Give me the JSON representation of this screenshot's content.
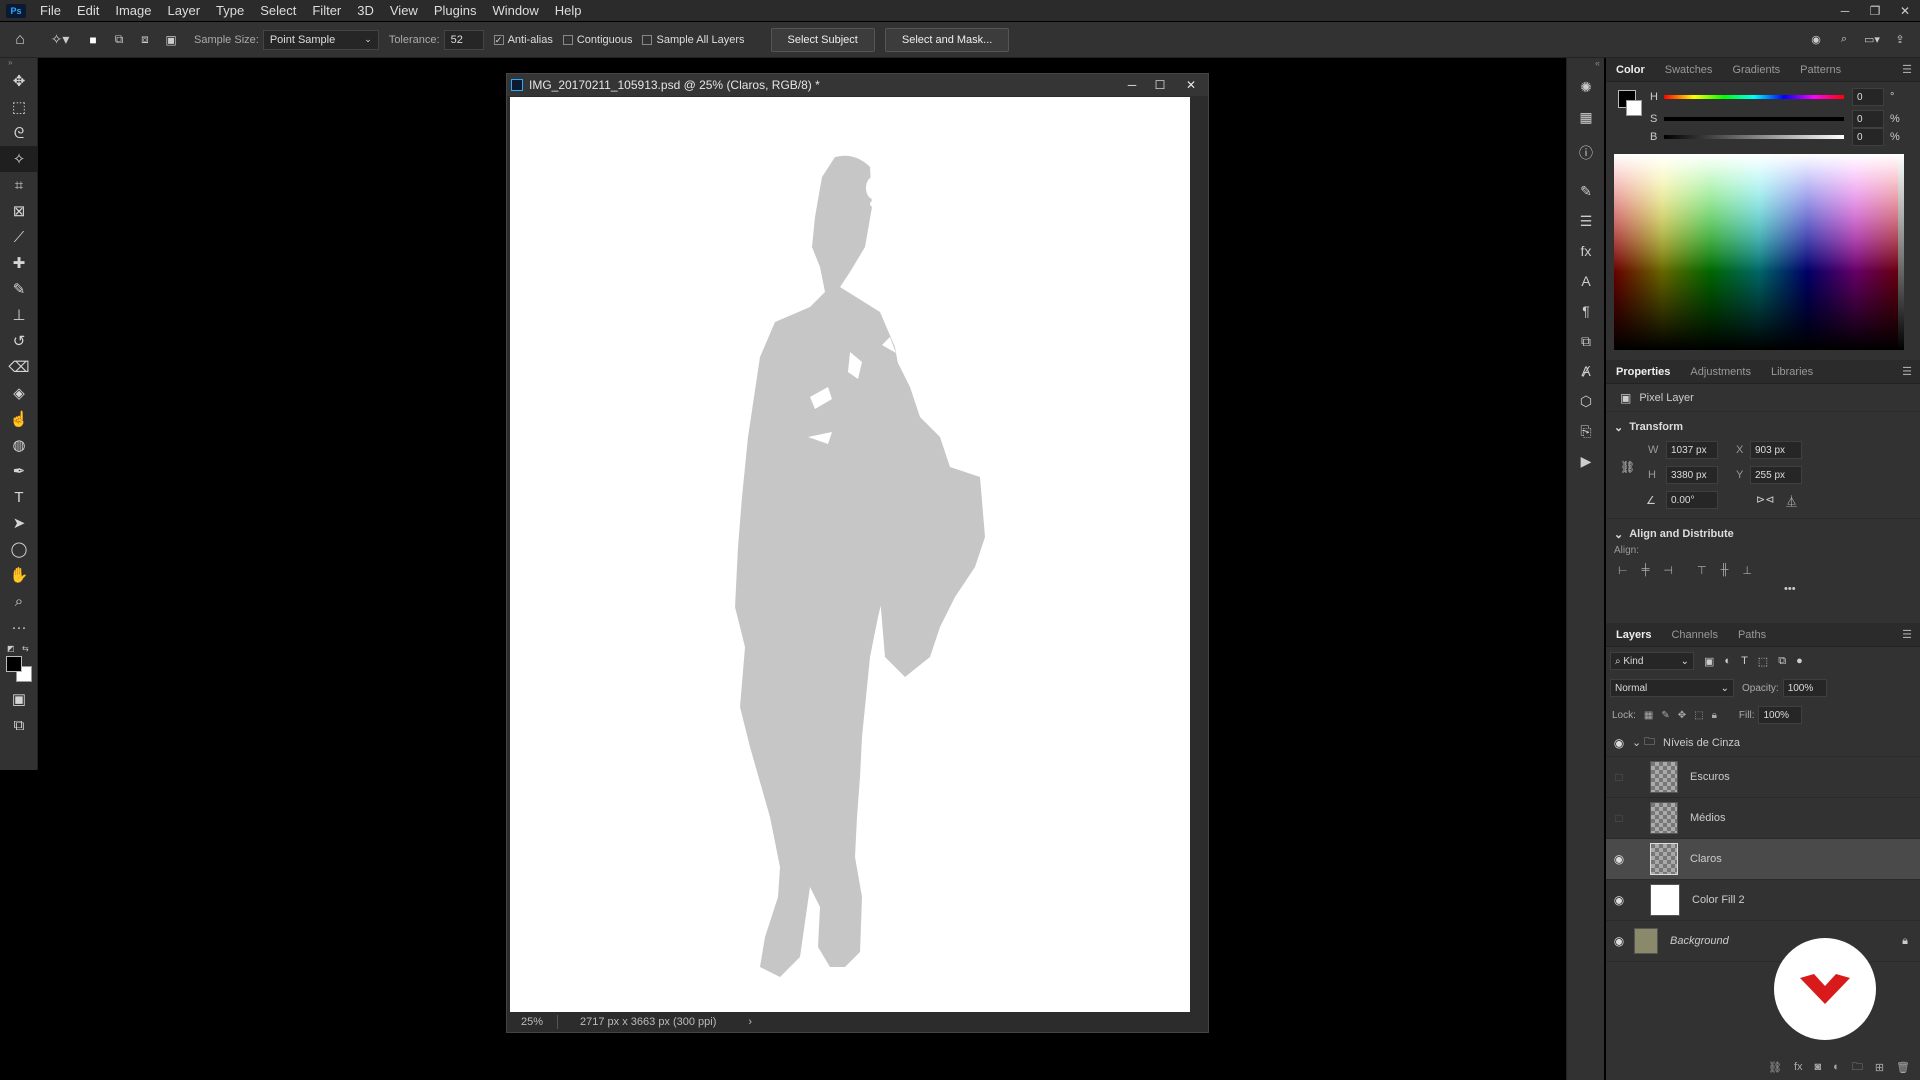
{
  "menu": {
    "logo": "Ps",
    "items": [
      "File",
      "Edit",
      "Image",
      "Layer",
      "Type",
      "Select",
      "Filter",
      "3D",
      "View",
      "Plugins",
      "Window",
      "Help"
    ]
  },
  "options": {
    "sample_size_label": "Sample Size:",
    "sample_size_value": "Point Sample",
    "tolerance_label": "Tolerance:",
    "tolerance_value": "52",
    "anti_alias": "Anti-alias",
    "contiguous": "Contiguous",
    "sample_all_layers": "Sample All Layers",
    "select_subject": "Select Subject",
    "select_and_mask": "Select and Mask..."
  },
  "document": {
    "title": "IMG_20170211_105913.psd @ 25% (Claros, RGB/8) *",
    "zoom": "25%",
    "info": "2717 px x 3663 px (300 ppi)"
  },
  "color_panel": {
    "tabs": [
      "Color",
      "Swatches",
      "Gradients",
      "Patterns"
    ],
    "h_label": "H",
    "h_value": "0",
    "h_unit": "°",
    "s_label": "S",
    "s_value": "0",
    "s_unit": "%",
    "b_label": "B",
    "b_value": "0",
    "b_unit": "%"
  },
  "properties": {
    "tabs": [
      "Properties",
      "Adjustments",
      "Libraries"
    ],
    "kind": "Pixel Layer",
    "transform_title": "Transform",
    "w_label": "W",
    "w": "1037 px",
    "h_label": "H",
    "h": "3380 px",
    "x_label": "X",
    "x": "903 px",
    "y_label": "Y",
    "y": "255 px",
    "angle": "0.00°",
    "align_title": "Align and Distribute",
    "align_label": "Align:"
  },
  "layers_panel": {
    "tabs": [
      "Layers",
      "Channels",
      "Paths"
    ],
    "filter": "Kind",
    "blend": "Normal",
    "opacity_label": "Opacity:",
    "opacity": "100%",
    "lock_label": "Lock:",
    "fill_label": "Fill:",
    "fill": "100%",
    "layers": [
      {
        "name": "Níveis de Cinza"
      },
      {
        "name": "Escuros"
      },
      {
        "name": "Médios"
      },
      {
        "name": "Claros"
      },
      {
        "name": "Color Fill 2"
      },
      {
        "name": "Background"
      }
    ]
  },
  "colors": {
    "accent": "#31a8ff",
    "brand_badge": "#d91a1a"
  }
}
